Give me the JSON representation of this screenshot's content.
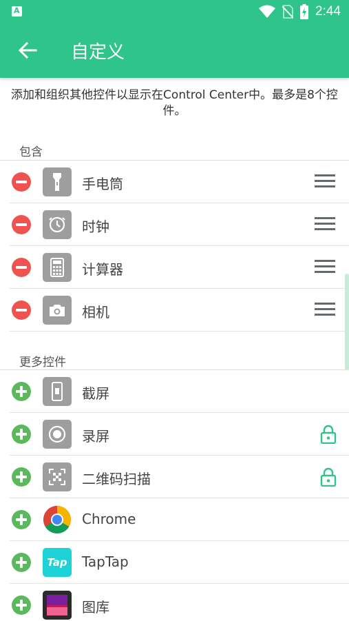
{
  "status_bar": {
    "time": "2:44"
  },
  "app_bar": {
    "title": "自定义"
  },
  "description": "添加和组织其他控件以显示在Control Center中。最多是8个控件。",
  "included": {
    "header": "包含",
    "items": [
      {
        "label": "手电筒",
        "icon": "flashlight-icon"
      },
      {
        "label": "时钟",
        "icon": "timer-icon"
      },
      {
        "label": "计算器",
        "icon": "calculator-icon"
      },
      {
        "label": "相机",
        "icon": "camera-icon"
      }
    ]
  },
  "more": {
    "header": "更多控件",
    "items": [
      {
        "label": "截屏",
        "icon": "screenshot-icon",
        "locked": false
      },
      {
        "label": "录屏",
        "icon": "screen-record-icon",
        "locked": true
      },
      {
        "label": "二维码扫描",
        "icon": "qr-scan-icon",
        "locked": true
      },
      {
        "label": "Chrome",
        "icon": "chrome-icon",
        "locked": false
      },
      {
        "label": "TapTap",
        "icon": "taptap-icon",
        "locked": false,
        "icon_text": "Tap"
      },
      {
        "label": "图库",
        "icon": "gallery-icon",
        "locked": false
      }
    ]
  },
  "colors": {
    "accent": "#2fc48a",
    "remove": "#ef5350",
    "add": "#5cb85c",
    "lock": "#2fc48a"
  }
}
